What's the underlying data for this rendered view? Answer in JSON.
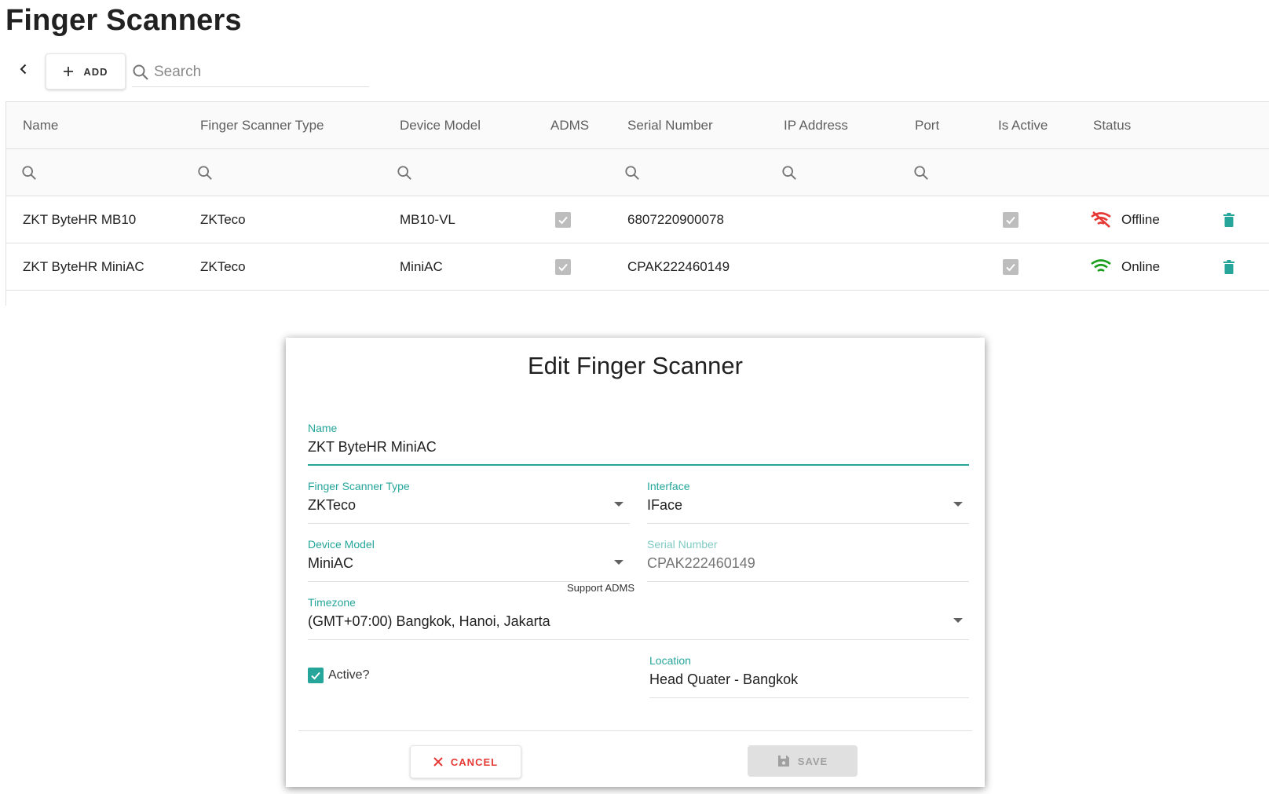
{
  "page": {
    "title": "Finger Scanners"
  },
  "toolbar": {
    "add_label": "ADD",
    "search_placeholder": "Search"
  },
  "table": {
    "columns": [
      "Name",
      "Finger Scanner Type",
      "Device Model",
      "ADMS",
      "Serial Number",
      "IP Address",
      "Port",
      "Is Active",
      "Status"
    ],
    "rows": [
      {
        "name": "ZKT ByteHR MB10",
        "type": "ZKTeco",
        "model": "MB10-VL",
        "adms": true,
        "serial": "6807220900078",
        "ip": "",
        "port": "",
        "is_active": true,
        "status": "Offline"
      },
      {
        "name": "ZKT ByteHR MiniAC",
        "type": "ZKTeco",
        "model": "MiniAC",
        "adms": true,
        "serial": "CPAK222460149",
        "ip": "",
        "port": "",
        "is_active": true,
        "status": "Online"
      }
    ]
  },
  "dialog": {
    "title": "Edit Finger Scanner",
    "name_label": "Name",
    "name_value": "ZKT ByteHR MiniAC",
    "type_label": "Finger Scanner Type",
    "type_value": "ZKTeco",
    "interface_label": "Interface",
    "interface_value": "IFace",
    "model_label": "Device Model",
    "model_value": "MiniAC",
    "model_helper": "Support ADMS",
    "serial_label": "Serial Number",
    "serial_value": "CPAK222460149",
    "timezone_label": "Timezone",
    "timezone_value": "(GMT+07:00) Bangkok, Hanoi, Jakarta",
    "active_label": "Active?",
    "active_checked": true,
    "location_label": "Location",
    "location_value": "Head Quater - Bangkok",
    "cancel_label": "CANCEL",
    "save_label": "SAVE"
  },
  "colors": {
    "accent": "#26a69a",
    "offline": "#e53935",
    "online": "#1b9e1b",
    "delete": "#26a69a"
  }
}
